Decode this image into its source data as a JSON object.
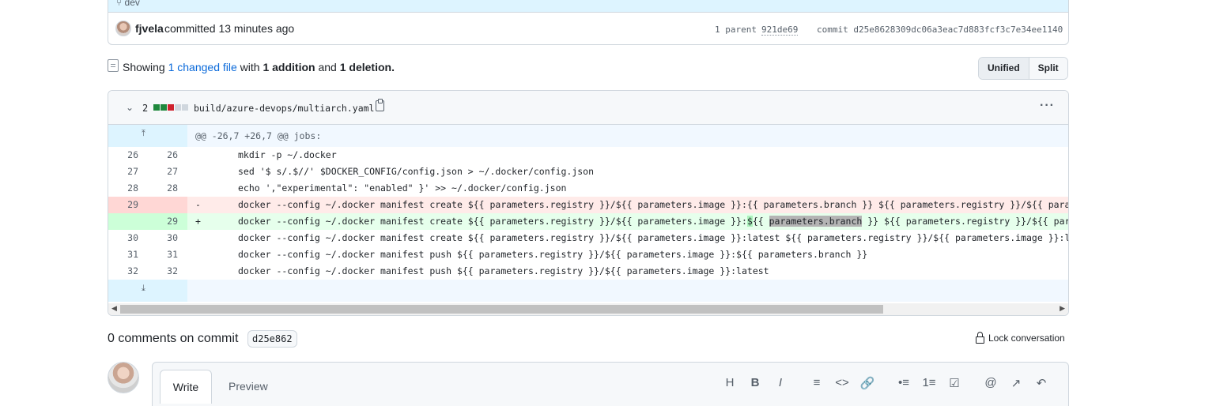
{
  "commit": {
    "branch": "dev",
    "author": "fjvela",
    "committed": "committed 13 minutes ago",
    "parent_label": "1 parent",
    "parent_sha": "921de69",
    "commit_label": "commit d25e8628309dc06a3eac7d883fcf3c7e34ee1140"
  },
  "summary": {
    "showing": "Showing",
    "changed": "1 changed file",
    "with": "with",
    "additions": "1 addition",
    "and": "and",
    "deletions": "1 deletion",
    "period": "."
  },
  "view_toggle": {
    "unified": "Unified",
    "split": "Split"
  },
  "file": {
    "change_count": "2",
    "name": "build/azure-devops/multiarch.yaml",
    "hunk_header": "@@ -26,7 +26,7 @@ jobs:",
    "stat_colors": [
      "#1f883d",
      "#1f883d",
      "#cf222e",
      "#d0d7de",
      "#d0d7de"
    ]
  },
  "diff_lines": [
    {
      "old": "26",
      "new": "26",
      "sign": "",
      "type": "ctx",
      "code": "mkdir -p ~/.docker"
    },
    {
      "old": "27",
      "new": "27",
      "sign": "",
      "type": "ctx",
      "code": "sed '$ s/.$//' $DOCKER_CONFIG/config.json > ~/.docker/config.json"
    },
    {
      "old": "28",
      "new": "28",
      "sign": "",
      "type": "ctx",
      "code": "echo ',\"experimental\": \"enabled\" }' >> ~/.docker/config.json"
    },
    {
      "old": "29",
      "new": "",
      "sign": "-",
      "type": "del",
      "code": "docker --config ~/.docker manifest create ${{ parameters.registry }}/${{ parameters.image }}:{{ parameters.branch }} ${{ parameters.registry }}/${{ parameters."
    },
    {
      "old": "",
      "new": "29",
      "sign": "+",
      "type": "add",
      "code_a": "docker --config ~/.docker manifest create ${{ parameters.registry }}/${{ parameters.image }}:",
      "code_b": "$",
      "code_c": "{{ ",
      "code_d": "parameters.branch",
      "code_e": " }} ${{ parameters.registry }}/${{ parameters"
    },
    {
      "old": "30",
      "new": "30",
      "sign": "",
      "type": "ctx",
      "code": "docker --config ~/.docker manifest create ${{ parameters.registry }}/${{ parameters.image }}:latest ${{ parameters.registry }}/${{ parameters.image }}:linux-la"
    },
    {
      "old": "31",
      "new": "31",
      "sign": "",
      "type": "ctx",
      "code": "docker --config ~/.docker manifest push ${{ parameters.registry }}/${{ parameters.image }}:${{ parameters.branch }}"
    },
    {
      "old": "32",
      "new": "32",
      "sign": "",
      "type": "ctx",
      "code": "docker --config ~/.docker manifest push ${{ parameters.registry }}/${{ parameters.image }}:latest"
    }
  ],
  "comments": {
    "title": "0 comments on commit",
    "sha": "d25e862",
    "lock": "Lock conversation"
  },
  "editor": {
    "tab_write": "Write",
    "tab_preview": "Preview",
    "tools": [
      "H",
      "B",
      "I",
      "≡",
      "<>",
      "🔗",
      "•≡",
      "1≡",
      "☑",
      "@",
      "↗",
      "↶"
    ]
  },
  "icons": {
    "branch": "git-branch-icon",
    "chevron": "chevron-down-icon",
    "copy": "copy-icon",
    "kebab": "kebab-horizontal-icon",
    "expand_up": "expand-up-icon",
    "expand_down": "expand-down-icon",
    "lock": "lock-icon"
  }
}
